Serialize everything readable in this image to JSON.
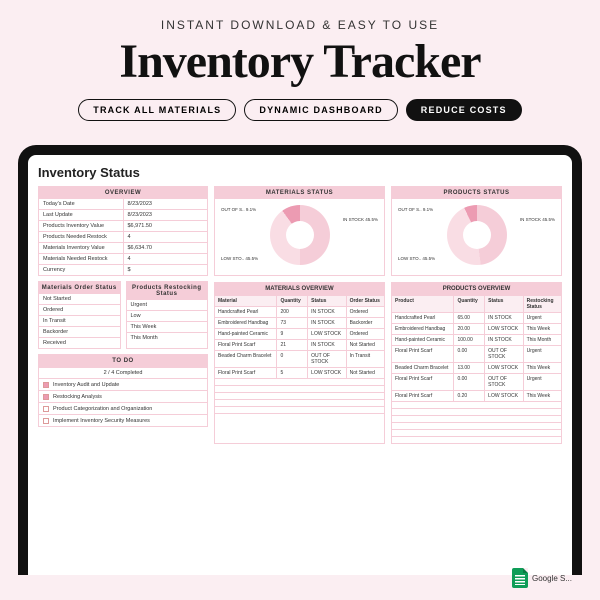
{
  "hero": {
    "tag": "INSTANT DOWNLOAD & EASY TO USE",
    "title": "Inventory Tracker",
    "pills": [
      "TRACK ALL MATERIALS",
      "DYNAMIC DASHBOARD",
      "REDUCE COSTS"
    ]
  },
  "dashboard": {
    "title": "Inventory Status",
    "overview": {
      "head": "OVERVIEW",
      "rows": [
        [
          "Today's Date",
          "8/23/2023"
        ],
        [
          "Last Update",
          "8/23/2023"
        ],
        [
          "Products Inventory Value",
          "$6,971.50"
        ],
        [
          "Products Needed Restock",
          "4"
        ],
        [
          "Materials Inventory Value",
          "$6,634.70"
        ],
        [
          "Materials Needed Restock",
          "4"
        ],
        [
          "Currency",
          "$"
        ]
      ]
    },
    "matOrder": {
      "head": "Materials Order Status",
      "items": [
        "Not Started",
        "Ordered",
        "In Transit",
        "Backorder",
        "Received"
      ]
    },
    "prodRestock": {
      "head": "Products Restocking Status",
      "items": [
        "Urgent",
        "Low",
        "This Week",
        "This Month"
      ]
    },
    "todo": {
      "head": "TO DO",
      "progress": "2 / 4 Completed",
      "items": [
        {
          "done": true,
          "label": "Inventory Audit and Update"
        },
        {
          "done": true,
          "label": "Restocking Analysis"
        },
        {
          "done": false,
          "label": "Product Categorization and Organization"
        },
        {
          "done": false,
          "label": "Implement Inventory Security Measures"
        }
      ]
    },
    "materialsStatus": {
      "head": "MATERIALS STATUS",
      "labels": {
        "in": "IN STOCK\n45.5%",
        "low": "LOW STO..\n45.5%",
        "out": "OUT OF S..\n9.1%"
      }
    },
    "productsStatus": {
      "head": "PRODUCTS STATUS",
      "labels": {
        "in": "IN STOCK\n45.5%",
        "low": "LOW STO..\n45.5%",
        "out": "OUT OF S..\n9.1%"
      }
    },
    "materialsOverview": {
      "head": "MATERIALS OVERVIEW",
      "cols": [
        "Material",
        "Quantity",
        "Status",
        "Order Status"
      ],
      "rows": [
        [
          "Handcrafted Pearl",
          "200",
          "IN STOCK",
          "Ordered"
        ],
        [
          "Embroidered Handbag",
          "73",
          "IN STOCK",
          "Backorder"
        ],
        [
          "Hand-painted Ceramic",
          "9",
          "LOW STOCK",
          "Ordered"
        ],
        [
          "Floral Print Scarf",
          "21",
          "IN STOCK",
          "Not Started"
        ],
        [
          "Beaded Charm Bracelet",
          "0",
          "OUT OF STOCK",
          "In Transit"
        ],
        [
          "Floral Print Scarf",
          "5",
          "LOW STOCK",
          "Not Started"
        ]
      ]
    },
    "productsOverview": {
      "head": "PRODUCTS OVERVIEW",
      "cols": [
        "Product",
        "Quantity",
        "Status",
        "Restocking Status"
      ],
      "rows": [
        [
          "Handcrafted Pearl",
          "65.00",
          "IN STOCK",
          "Urgent"
        ],
        [
          "Embroidered Handbag",
          "20.00",
          "LOW STOCK",
          "This Week"
        ],
        [
          "Hand-painted Ceramic",
          "100.00",
          "IN STOCK",
          "This Month"
        ],
        [
          "Floral Print Scarf",
          "0.00",
          "OUT OF STOCK",
          "Urgent"
        ],
        [
          "Beaded Charm Bracelet",
          "13.00",
          "LOW STOCK",
          "This Week"
        ],
        [
          "Floral Print Scarf",
          "0.00",
          "OUT OF STOCK",
          "Urgent"
        ],
        [
          "Floral Print Scarf",
          "0.20",
          "LOW STOCK",
          "This Week"
        ]
      ]
    }
  },
  "footer": {
    "sheets": "Google S..."
  },
  "chart_data": [
    {
      "type": "pie",
      "title": "MATERIALS STATUS",
      "categories": [
        "IN STOCK",
        "LOW STOCK",
        "OUT OF STOCK"
      ],
      "values": [
        45.5,
        45.5,
        9.1
      ]
    },
    {
      "type": "pie",
      "title": "PRODUCTS STATUS",
      "categories": [
        "IN STOCK",
        "LOW STOCK",
        "OUT OF STOCK"
      ],
      "values": [
        45.5,
        45.5,
        9.1
      ]
    }
  ]
}
